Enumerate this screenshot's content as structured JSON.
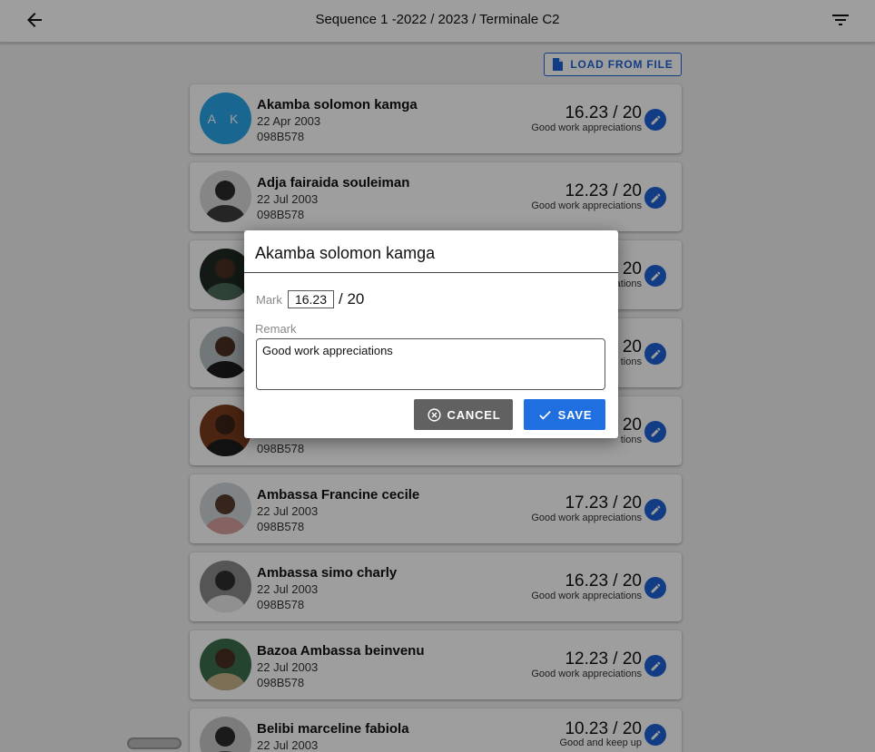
{
  "appbar": {
    "title": "Sequence 1 -2022 / 2023 / Terminale C2",
    "back_icon": "arrow-left-icon",
    "filter_icon": "filter-icon"
  },
  "toolbar": {
    "load_label": "LOAD FROM FILE",
    "load_icon": "file-icon"
  },
  "students": [
    {
      "name": "Akamba solomon kamga",
      "dob": "22 Apr 2003",
      "code": "098B578",
      "score": "16.23 / 20",
      "remark": "Good work appreciations",
      "initials": "A K"
    },
    {
      "name": "Adja fairaida souleiman",
      "dob": "22 Jul 2003",
      "code": "098B578",
      "score": "12.23 / 20",
      "remark": "Good work appreciations"
    },
    {
      "name": "",
      "dob": "",
      "code": "",
      "score": "20",
      "remark": "ations"
    },
    {
      "name": "",
      "dob": "",
      "code": "",
      "score": "20",
      "remark": "tions"
    },
    {
      "name": "",
      "dob": "",
      "code": "098B578",
      "score": "20",
      "remark": "tions"
    },
    {
      "name": "Ambassa Francine cecile",
      "dob": "22 Jul 2003",
      "code": "098B578",
      "score": "17.23 / 20",
      "remark": "Good work appreciations"
    },
    {
      "name": "Ambassa simo charly",
      "dob": "22 Jul 2003",
      "code": "098B578",
      "score": "16.23 / 20",
      "remark": "Good work appreciations"
    },
    {
      "name": "Bazoa Ambassa beinvenu",
      "dob": "22 Jul 2003",
      "code": "098B578",
      "score": "12.23 / 20",
      "remark": "Good work appreciations"
    },
    {
      "name": "Belibi marceline fabiola",
      "dob": "22 Jul 2003",
      "code": "",
      "score": "10.23 / 20",
      "remark": "Good  and keep up"
    }
  ],
  "dialog": {
    "title": "Akamba solomon kamga",
    "mark_label": "Mark",
    "mark_value": "16.23",
    "mark_total": "/ 20",
    "remark_label": "Remark",
    "remark_value": "Good work appreciations",
    "cancel_label": "CANCEL",
    "save_label": "SAVE"
  },
  "colors": {
    "accent": "#1e63d6",
    "avatar_initials_bg": "#29a6e8",
    "cancel_bg": "#616161"
  }
}
